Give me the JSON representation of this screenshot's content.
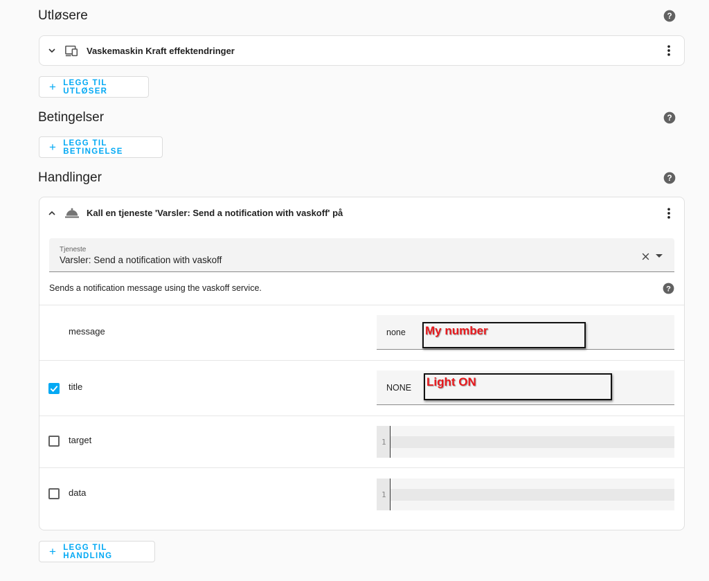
{
  "triggers": {
    "title": "Utløsere",
    "items": [
      {
        "label": "Vaskemaskin Kraft effektendringer",
        "icon": "device-icon"
      }
    ],
    "add_label": "LEGG TIL UTLØSER"
  },
  "conditions": {
    "title": "Betingelser",
    "add_label": "LEGG TIL BETINGELSE"
  },
  "actions": {
    "title": "Handlinger",
    "action": {
      "label": "Kall en tjeneste 'Varsler: Send a notification with vaskoff' på",
      "icon": "service-bell-icon",
      "service_field": {
        "label": "Tjeneste",
        "value": "Varsler: Send a notification with vaskoff"
      },
      "description": "Sends a notification message using the vaskoff service.",
      "fields": [
        {
          "name": "message",
          "checked": null,
          "value": "none",
          "annotation": "My number"
        },
        {
          "name": "title",
          "checked": true,
          "value": "NONE",
          "annotation": "Light ON"
        },
        {
          "name": "target",
          "checked": false,
          "line_number": "1"
        },
        {
          "name": "data",
          "checked": false,
          "line_number": "1"
        }
      ]
    },
    "add_label": "LEGG TIL HANDLING"
  },
  "colors": {
    "accent": "#03a9f4",
    "annotation_text": "#e8191d",
    "page_bg": "#fafafa"
  }
}
